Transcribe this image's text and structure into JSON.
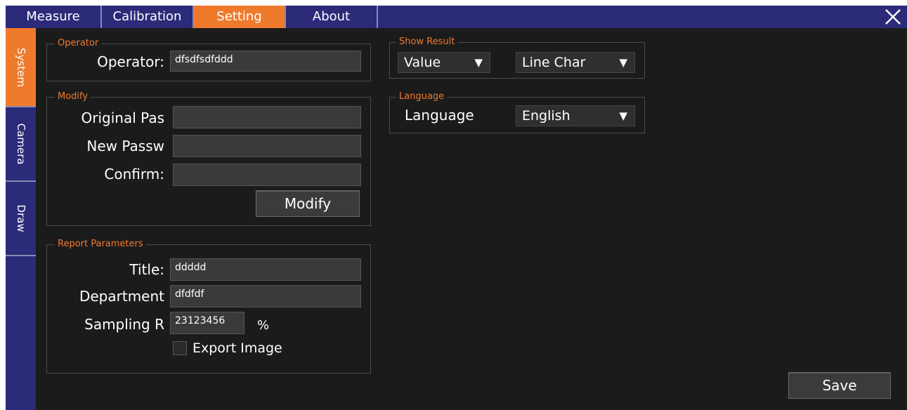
{
  "tabs": {
    "measure": "Measure",
    "calibration": "Calibration",
    "setting": "Setting",
    "about": "About"
  },
  "sidebar": {
    "system": "System",
    "camera": "Camera",
    "draw": "Draw"
  },
  "operator": {
    "legend": "Operator",
    "label": "Operator:",
    "value": "dfsdfsdfddd"
  },
  "modify": {
    "legend": "Modify",
    "original_label": "Original Pas",
    "new_label": "New Passw",
    "confirm_label": "Confirm:",
    "original_value": "",
    "new_value": "",
    "confirm_value": "",
    "button": "Modify"
  },
  "report": {
    "legend": "Report Parameters",
    "title_label": "Title:",
    "title_value": "ddddd",
    "department_label": "Department",
    "department_value": "dfdfdf",
    "sampling_label": "Sampling R",
    "sampling_value": "23123456",
    "percent": "%",
    "export_label": "Export Image",
    "export_checked": false
  },
  "show_result": {
    "legend": "Show Result",
    "value_select": "Value",
    "chart_select": "Line Char"
  },
  "language": {
    "legend": "Language",
    "label": "Language",
    "value": "English"
  },
  "save_button": "Save",
  "colors": {
    "accent": "#f07a2c",
    "bar": "#2b2b7a",
    "background": "#1b1b1b"
  },
  "icons": {
    "close": "close-icon",
    "dropdown": "triangle-down-icon"
  }
}
